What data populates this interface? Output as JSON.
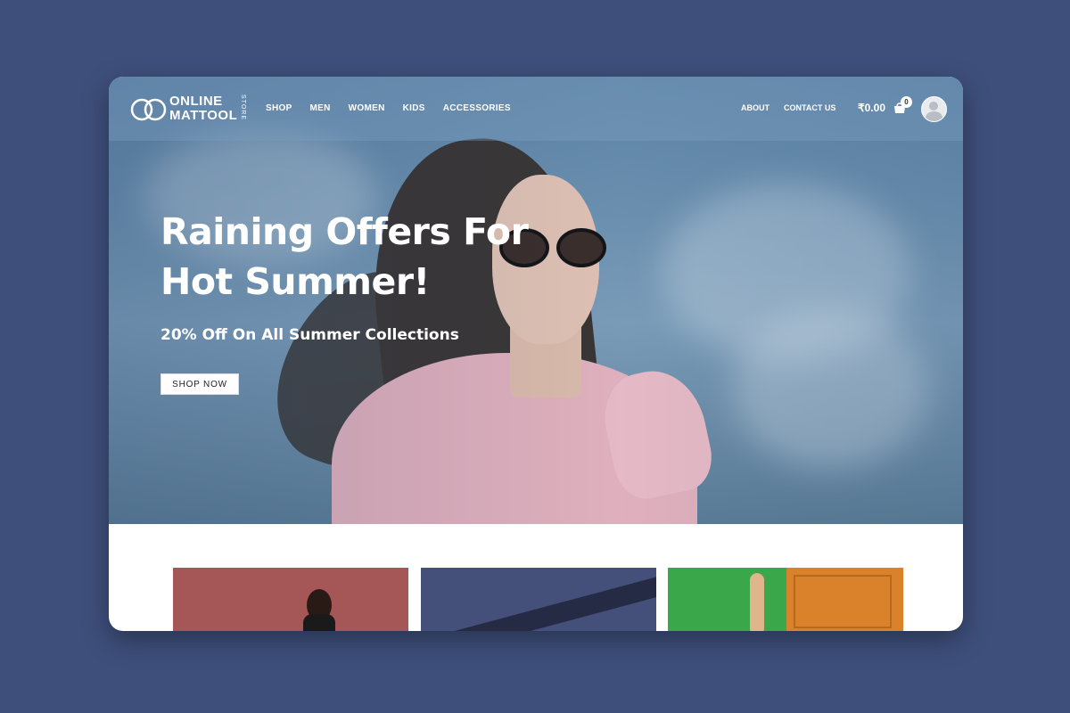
{
  "brand": {
    "line1": "ONLINE",
    "line2": "MATTOOL",
    "side": "STORE"
  },
  "nav": {
    "left": [
      "SHOP",
      "MEN",
      "WOMEN",
      "KIDS",
      "ACCESSORIES"
    ],
    "right": [
      "ABOUT",
      "CONTACT US"
    ],
    "cart_total": "₹0.00",
    "cart_count": "0"
  },
  "hero": {
    "headline": "Raining Offers For Hot Summer!",
    "subheadline": "20% Off On All Summer Collections",
    "cta": "SHOP NOW"
  },
  "colors": {
    "background": "#3e4f7b",
    "hero_tint": "#6e93b2",
    "card1": "#a55656",
    "card2": "#44507a",
    "card3": "#3aa84a"
  },
  "icons": {
    "cart": "cart-icon",
    "user": "user-avatar-icon",
    "logo": "rings-logo-icon"
  }
}
